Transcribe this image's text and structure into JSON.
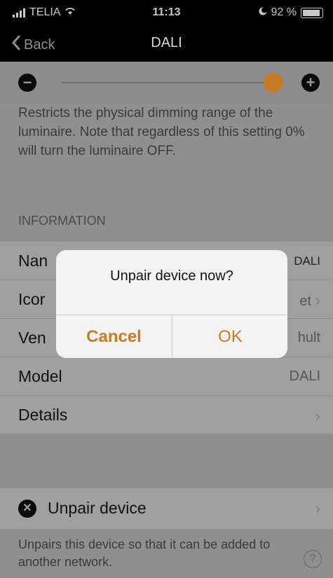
{
  "status": {
    "carrier": "TELIA",
    "time": "11:13",
    "battery": "92 %"
  },
  "nav": {
    "back_label": "Back",
    "title": "DALI"
  },
  "dimmer": {
    "minus": "−",
    "plus": "+",
    "level": 1.0,
    "accent": "#c97a25"
  },
  "description": "Restricts the physical dimming range of the luminaire. Note that regardless of this setting 0% will turn the luminaire OFF.",
  "information": {
    "header": "INFORMATION",
    "rows": [
      {
        "label": "Nan",
        "value": "DALI",
        "chevron": ""
      },
      {
        "label": "Icor",
        "value": "et",
        "chevron": "›"
      },
      {
        "label": "Ven",
        "value": "hult",
        "chevron": ""
      },
      {
        "label": "Model",
        "value": "DALI",
        "chevron": ""
      },
      {
        "label": "Details",
        "value": "",
        "chevron": "›"
      }
    ]
  },
  "unpair": {
    "label": "Unpair device",
    "chevron": "›",
    "icon": "close-icon"
  },
  "footer": {
    "text": "Unpairs this device so that it can be added to another network.",
    "help": "?"
  },
  "alert": {
    "message": "Unpair device now?",
    "cancel_label": "Cancel",
    "ok_label": "OK"
  }
}
